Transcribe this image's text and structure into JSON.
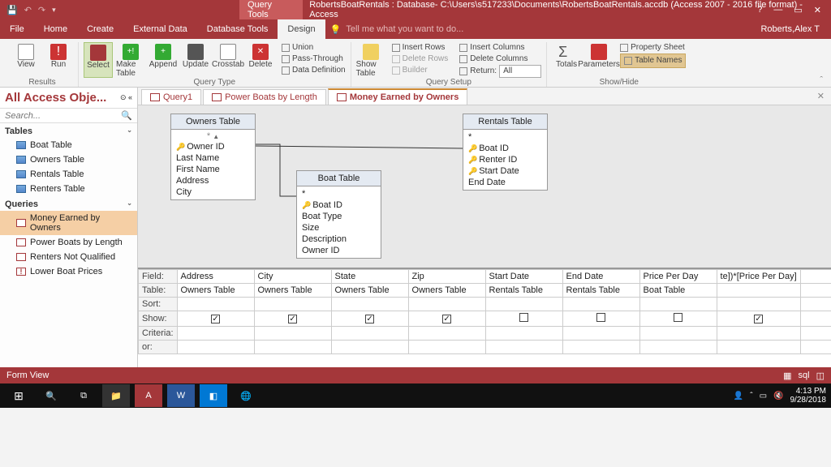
{
  "title": {
    "queryTools": "Query Tools",
    "full": "RobertsBoatRentals : Database- C:\\Users\\s517233\\Documents\\RobertsBoatRentals.accdb (Access 2007 - 2016 file format) - Access"
  },
  "menu": {
    "file": "File",
    "home": "Home",
    "create": "Create",
    "external": "External Data",
    "dbtools": "Database Tools",
    "design": "Design",
    "tell": "Tell me what you want to do...",
    "user": "Roberts,Alex T"
  },
  "ribbon": {
    "results": {
      "view": "View",
      "run": "Run",
      "label": "Results"
    },
    "qtype": {
      "select": "Select",
      "make": "Make\nTable",
      "append": "Append",
      "update": "Update",
      "crosstab": "Crosstab",
      "delete": "Delete",
      "union": "Union",
      "pass": "Pass-Through",
      "datadef": "Data Definition",
      "label": "Query Type"
    },
    "qsetup": {
      "show": "Show\nTable",
      "insRow": "Insert Rows",
      "delRow": "Delete Rows",
      "builder": "Builder",
      "insCol": "Insert Columns",
      "delCol": "Delete Columns",
      "return": "Return:",
      "retval": "All",
      "label": "Query Setup"
    },
    "showhide": {
      "totals": "Totals",
      "params": "Parameters",
      "prop": "Property Sheet",
      "tnames": "Table Names",
      "label": "Show/Hide"
    }
  },
  "nav": {
    "hdr": "All Access Obje...",
    "search": "Search...",
    "tables": {
      "label": "Tables",
      "items": [
        "Boat Table",
        "Owners Table",
        "Rentals Table",
        "Renters Table"
      ]
    },
    "queries": {
      "label": "Queries",
      "items": [
        "Money Earned by Owners",
        "Power Boats by Length",
        "Renters Not Qualified",
        "Lower Boat Prices"
      ]
    }
  },
  "tabs": [
    "Query1",
    "Power Boats by Length",
    "Money Earned by Owners"
  ],
  "boxes": {
    "owners": {
      "title": "Owners Table",
      "fields": [
        "Owner ID",
        "Last Name",
        "First Name",
        "Address",
        "City"
      ],
      "keyIdx": [
        0
      ]
    },
    "boat": {
      "title": "Boat Table",
      "fields": [
        "*",
        "Boat ID",
        "Boat Type",
        "Size",
        "Description",
        "Owner ID"
      ],
      "keyIdx": [
        1
      ]
    },
    "rentals": {
      "title": "Rentals Table",
      "fields": [
        "*",
        "Boat ID",
        "Renter ID",
        "Start Date",
        "End Date"
      ],
      "keyIdx": [
        1,
        2,
        3
      ]
    }
  },
  "grid": {
    "rows": [
      "Field:",
      "Table:",
      "Sort:",
      "Show:",
      "Criteria:",
      "or:"
    ],
    "cols": [
      {
        "f": "Address",
        "t": "Owners Table",
        "show": true
      },
      {
        "f": "City",
        "t": "Owners Table",
        "show": true
      },
      {
        "f": "State",
        "t": "Owners Table",
        "show": true
      },
      {
        "f": "Zip",
        "t": "Owners Table",
        "show": true
      },
      {
        "f": "Start Date",
        "t": "Rentals Table",
        "show": false
      },
      {
        "f": "End Date",
        "t": "Rentals Table",
        "show": false
      },
      {
        "f": "Price Per Day",
        "t": "Boat Table",
        "show": false
      },
      {
        "f": "te])*[Price Per Day]",
        "t": "",
        "show": true
      },
      {
        "f": "",
        "t": "",
        "show": false
      }
    ]
  },
  "status": "Form View",
  "clock": {
    "time": "4:13 PM",
    "date": "9/28/2018"
  }
}
